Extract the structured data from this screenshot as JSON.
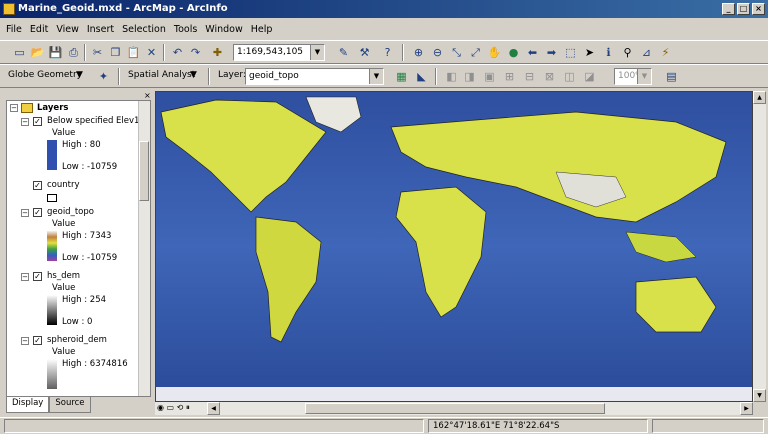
{
  "window": {
    "title": "Marine_Geoid.mxd - ArcMap - ArcInfo"
  },
  "menubar": {
    "items": [
      "File",
      "Edit",
      "View",
      "Insert",
      "Selection",
      "Tools",
      "Window",
      "Help"
    ]
  },
  "toolbar": {
    "scale_value": "1:169,543,105",
    "zoom_value": "100%"
  },
  "toolbar2": {
    "globe_label": "Globe Geometry",
    "spatial_label": "Spatial Analyst",
    "layer_label": "Layer:",
    "layer_value": "geoid_topo"
  },
  "toc": {
    "root": "Layers",
    "layers": [
      {
        "name": "Below specified Elev1",
        "value_label": "Value",
        "high": "High : 80",
        "low": "Low : -10759"
      },
      {
        "name": "country"
      },
      {
        "name": "geoid_topo",
        "value_label": "Value",
        "high": "High : 7343",
        "low": "Low : -10759"
      },
      {
        "name": "hs_dem",
        "value_label": "Value",
        "high": "High : 254",
        "low": "Low : 0"
      },
      {
        "name": "spheroid_dem",
        "value_label": "Value",
        "high": "High : 6374816"
      }
    ],
    "tabs": [
      "Display",
      "Source"
    ]
  },
  "status": {
    "coordinates": "162°47'18.61\"E  71°8'22.64\"S"
  },
  "colors": {
    "ocean": "#3657a8",
    "land": "#d8e04a",
    "titlebar": "#0a246a"
  }
}
